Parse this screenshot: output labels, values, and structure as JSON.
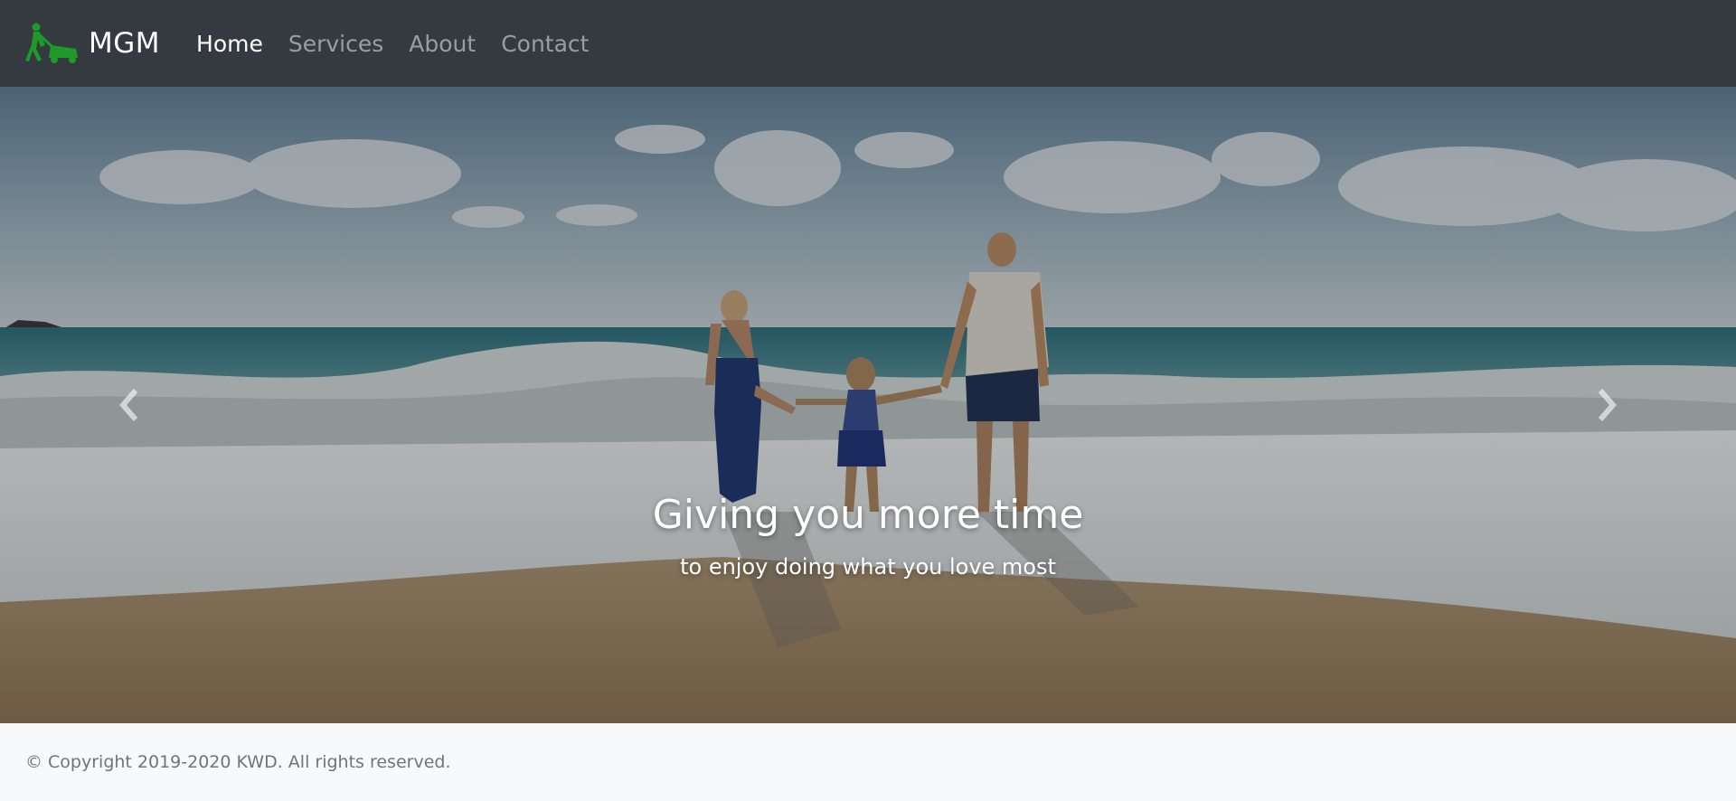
{
  "navbar": {
    "brand": "MGM",
    "logo_icon": "lawn-mower-icon",
    "logo_color": "#1f9a2a",
    "links": [
      {
        "label": "Home",
        "active": true
      },
      {
        "label": "Services",
        "active": false
      },
      {
        "label": "About",
        "active": false
      },
      {
        "label": "Contact",
        "active": false
      }
    ]
  },
  "carousel": {
    "image_subject": "family-at-beach-photo",
    "caption_title": "Giving you more time",
    "caption_subtitle": "to enjoy doing what you love most",
    "prev_icon": "chevron-left-icon",
    "next_icon": "chevron-right-icon"
  },
  "footer": {
    "copyright": "© Copyright 2019-2020 KWD. All rights reserved."
  },
  "colors": {
    "navbar_bg": "#343a40",
    "footer_bg": "#f8f9fa",
    "footer_text": "#6c757d"
  }
}
